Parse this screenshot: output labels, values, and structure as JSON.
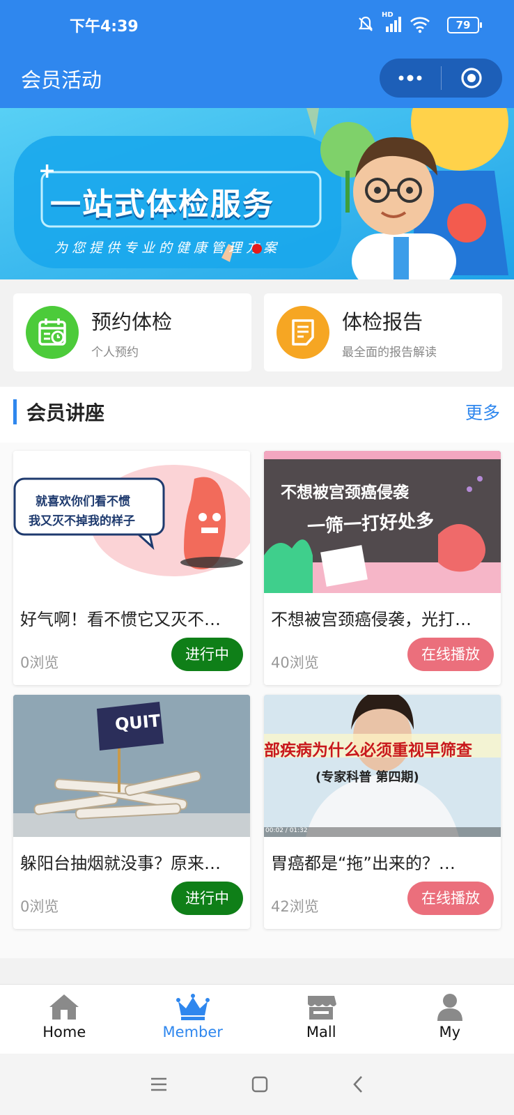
{
  "status": {
    "time": "下午4:39",
    "network": "HD",
    "battery": "79"
  },
  "header": {
    "title": "会员活动"
  },
  "banner": {
    "title": "一站式体检服务",
    "subtitle": "为您提供专业的健康管理方案"
  },
  "services": [
    {
      "title": "预约体检",
      "subtitle": "个人预约",
      "icon": "calendar-icon",
      "color": "#4ccb3a"
    },
    {
      "title": "体检报告",
      "subtitle": "最全面的报告解读",
      "icon": "document-icon",
      "color": "#f6a623"
    }
  ],
  "section": {
    "title": "会员讲座",
    "more": "更多"
  },
  "cards": [
    {
      "title": "好气啊！看不惯它又灭不…",
      "views": "0浏览",
      "button": "进行中",
      "thumb_text_1": "就喜欢你们看不惯",
      "thumb_text_2": "我又灭不掉我的样子"
    },
    {
      "title": "不想被宫颈癌侵袭，光打…",
      "views": "40浏览",
      "button": "在线播放",
      "thumb_text_1": "不想被宫颈癌侵袭",
      "thumb_text_2": "一筛一打好处多"
    },
    {
      "title": "躲阳台抽烟就没事？原来…",
      "views": "0浏览",
      "button": "进行中",
      "thumb_text_1": "QUIT"
    },
    {
      "title": "胃癌都是“拖”出来的？…",
      "views": "42浏览",
      "button": "在线播放",
      "thumb_text_1": "部疾病为什么必须重视早筛查",
      "thumb_text_2": "(专家科普  第四期)",
      "thumb_text_3": "00:02 / 01:32"
    }
  ],
  "tabs": [
    {
      "label": "Home",
      "icon": "home-icon"
    },
    {
      "label": "Member",
      "icon": "crown-icon",
      "active": true
    },
    {
      "label": "Mall",
      "icon": "store-icon"
    },
    {
      "label": "My",
      "icon": "user-icon"
    }
  ],
  "colors": {
    "brand": "#2f87ee",
    "active_green": "#0f7f18",
    "play_pink": "#eb6f7c"
  }
}
